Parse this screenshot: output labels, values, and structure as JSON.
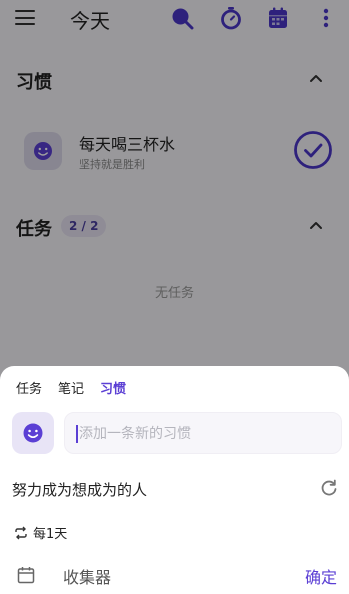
{
  "appbar": {
    "title": "今天",
    "icons": [
      "menu-icon",
      "search-icon",
      "timer-icon",
      "calendar-icon",
      "more-icon"
    ]
  },
  "habits_section": {
    "title": "习惯",
    "item": {
      "title": "每天喝三杯水",
      "subtitle": "坚持就是胜利",
      "completed": true
    }
  },
  "tasks_section": {
    "title": "任务",
    "badge": "2 / 2",
    "empty_text": "无任务"
  },
  "sheet": {
    "tabs": [
      {
        "label": "任务",
        "active": false
      },
      {
        "label": "笔记",
        "active": false
      },
      {
        "label": "习惯",
        "active": true
      }
    ],
    "input": {
      "placeholder": "添加一条新的习惯",
      "value": ""
    },
    "motto": "努力成为想成为的人",
    "repeat": "每1天",
    "collector": "收集器",
    "confirm": "确定"
  },
  "colors": {
    "accent": "#5b3fd4",
    "scrim": "rgba(0,0,0,0.38)",
    "sheet_bg": "#ffffff"
  }
}
